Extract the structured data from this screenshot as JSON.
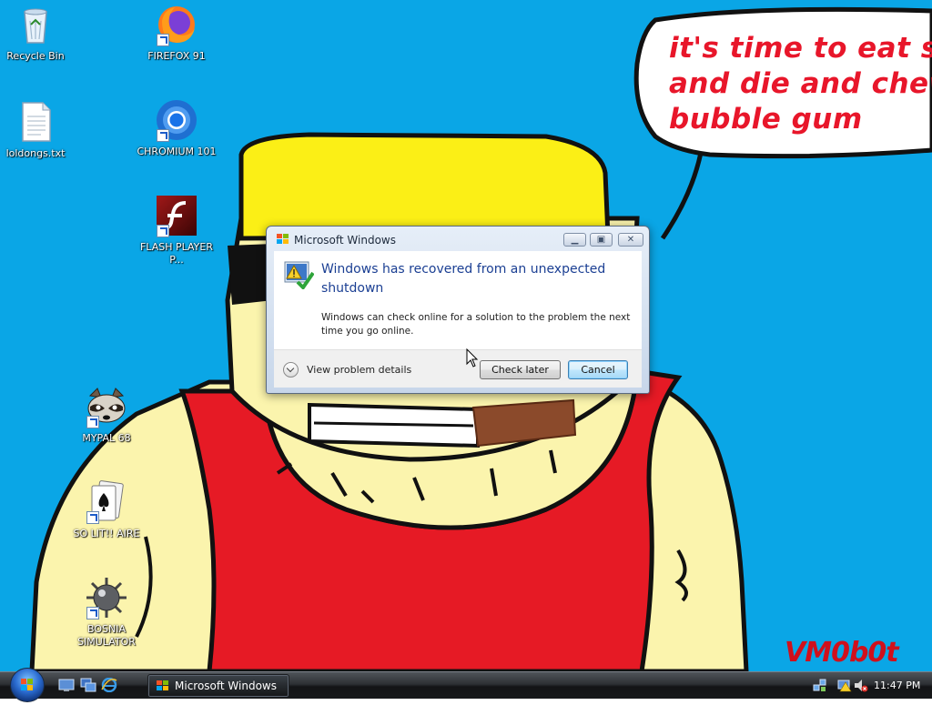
{
  "desktop": {
    "icons": [
      {
        "label": "Recycle Bin",
        "icon": "recycle-bin-icon"
      },
      {
        "label": "FIREFOX 91",
        "icon": "firefox-icon"
      },
      {
        "label": "loldongs.txt",
        "icon": "text-file-icon"
      },
      {
        "label": "CHROMIUM 101",
        "icon": "chromium-icon"
      },
      {
        "label": "FLASH PLAYER P...",
        "icon": "flash-player-icon"
      },
      {
        "label": "MYPAL 68",
        "icon": "raccoon-icon"
      },
      {
        "label": "SO LIT!! AIRE",
        "icon": "solitaire-icon"
      },
      {
        "label": "BOSNIA SIMULATOR",
        "icon": "mine-icon"
      }
    ],
    "wallpaper": {
      "speech_lines": [
        "it's time to eat shit",
        "and die and chew",
        "bubble gum"
      ],
      "signature": "VM0b0t",
      "colors": {
        "sky": "#0aa6e6",
        "text_red": "#e8162a",
        "hat_yellow": "#fbef16",
        "shirt_red": "#e61a25",
        "skin": "#fbf4ad"
      }
    }
  },
  "dialog": {
    "title": "Microsoft Windows",
    "heading": "Windows has recovered from an unexpected shutdown",
    "description": "Windows can check online for a solution to the problem the next time you go online.",
    "details_label": "View problem details",
    "check_later_label": "Check later",
    "cancel_label": "Cancel"
  },
  "taskbar": {
    "task_label": "Microsoft Windows",
    "clock": "11:47 PM"
  }
}
